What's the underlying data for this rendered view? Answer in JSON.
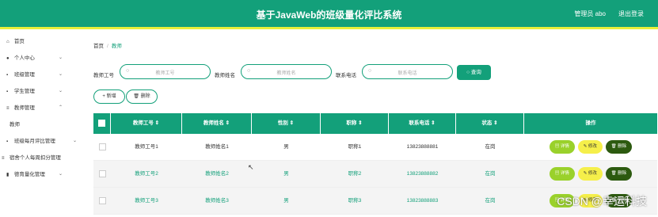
{
  "header": {
    "title": "基于JavaWeb的班级量化评比系统",
    "admin": "管理员 abo",
    "logout": "退出登录"
  },
  "sidebar": {
    "items": [
      {
        "label": "首页",
        "icon": "home-icon",
        "glyph": "⌂",
        "chevron": false
      },
      {
        "label": "个人中心",
        "icon": "user-icon",
        "glyph": "●",
        "chevron": true
      },
      {
        "label": "班级管理",
        "icon": "grid-icon",
        "glyph": "▪",
        "chevron": true
      },
      {
        "label": "学生管理",
        "icon": "grid-icon",
        "glyph": "▪",
        "chevron": true
      },
      {
        "label": "教师管理",
        "icon": "sliders-icon",
        "glyph": "≡",
        "chevron": true
      },
      {
        "label": "教师",
        "icon": "",
        "glyph": "",
        "chevron": false
      },
      {
        "label": "班级每月评比管理",
        "icon": "grid-icon",
        "glyph": "▪",
        "chevron": true
      },
      {
        "label": "宿舍个人每周扣分管理",
        "icon": "list-icon",
        "glyph": "≡",
        "chevron": false
      },
      {
        "label": "德育量化管理",
        "icon": "chart-icon",
        "glyph": "▮",
        "chevron": true
      }
    ]
  },
  "breadcrumb": {
    "home": "首页",
    "sep": "/",
    "current": "教师"
  },
  "filters": {
    "f1_label": "教师工号",
    "f1_placeholder": "教师工号",
    "f2_label": "教师姓名",
    "f2_placeholder": "教师姓名",
    "f3_label": "联系电话",
    "f3_placeholder": "联系电话",
    "search": "查询"
  },
  "actions": {
    "add": "+ 新增",
    "delete": "🗑 删除"
  },
  "table": {
    "headers": [
      "教师工号 ⇕",
      "教师姓名 ⇕",
      "性别 ⇕",
      "职称 ⇕",
      "联系电话 ⇕",
      "状态 ⇕",
      "操作"
    ],
    "rows": [
      [
        "教师工号1",
        "教师姓名1",
        "男",
        "职称1",
        "13823888881",
        "在岗"
      ],
      [
        "教师工号2",
        "教师姓名2",
        "男",
        "职称2",
        "13823888882",
        "在岗"
      ],
      [
        "教师工号3",
        "教师姓名3",
        "男",
        "职称3",
        "13823888883",
        "在岗"
      ]
    ],
    "btn_detail": "▤ 详情",
    "btn_edit": "✎ 修改",
    "btn_delete": "🗑 删除"
  },
  "watermark": "CSDN @幸运科技",
  "colors": {
    "primary": "#13a07a",
    "accent": "#e9f03a"
  }
}
